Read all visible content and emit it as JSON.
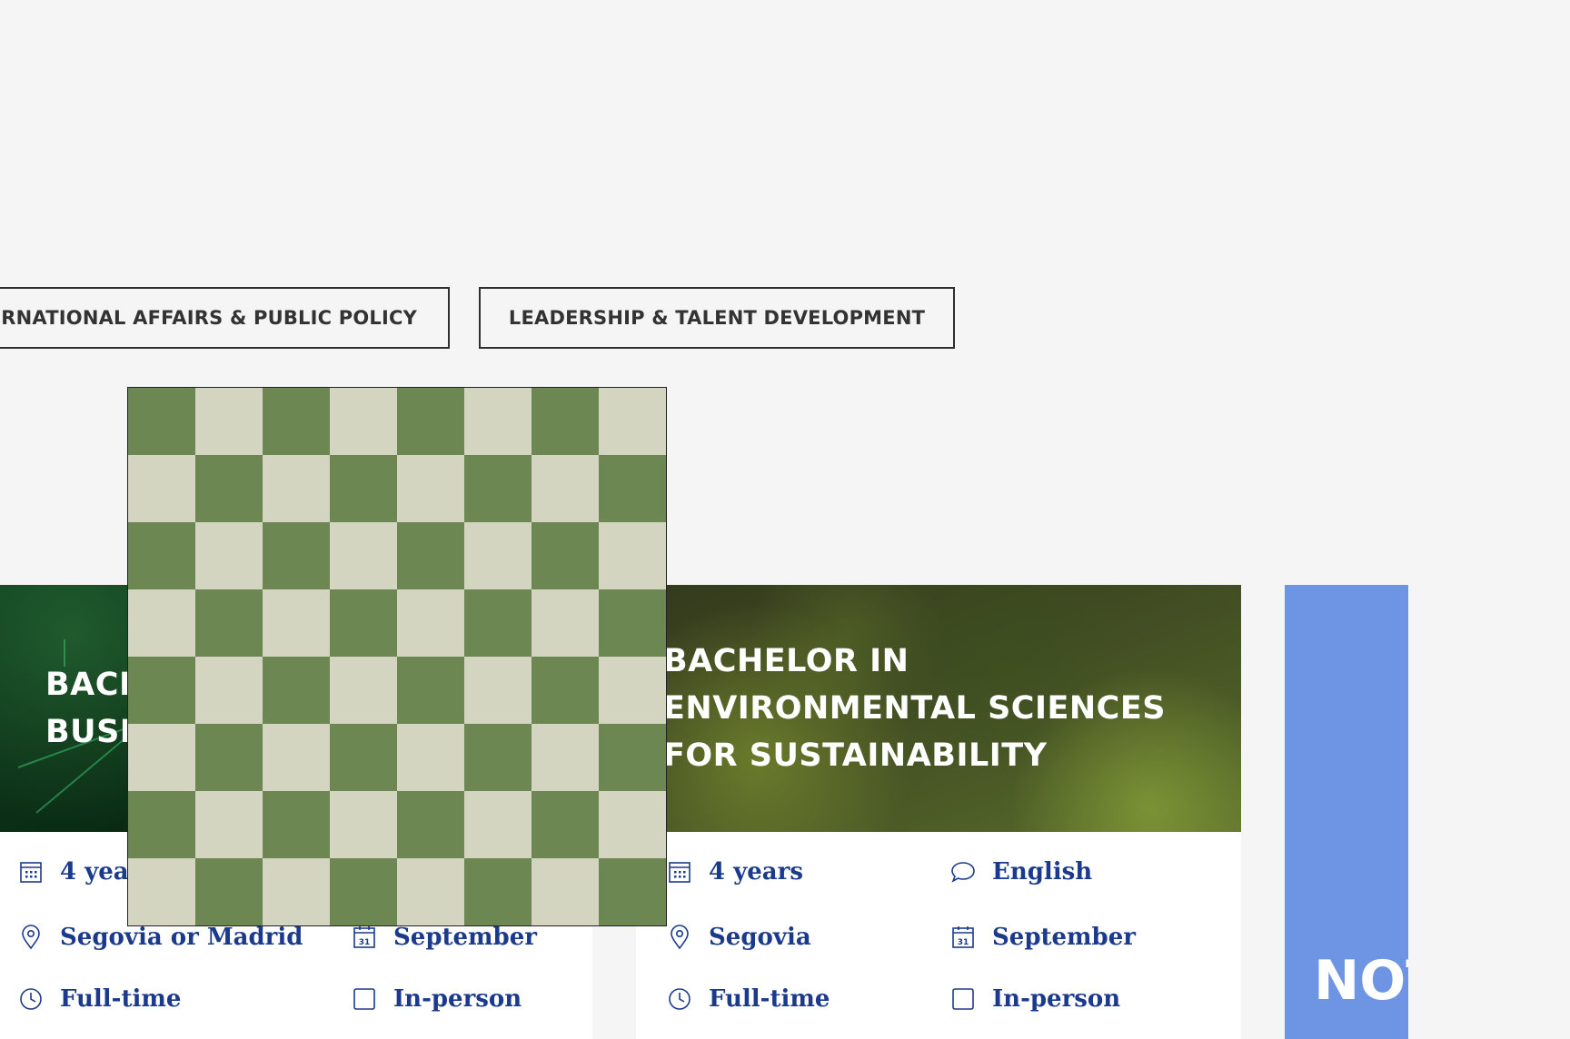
{
  "filters": [
    {
      "label": "INTERNATIONAL AFFAIRS & PUBLIC POLICY"
    },
    {
      "label": "LEADERSHIP & TALENT DEVELOPMENT"
    }
  ],
  "cards": [
    {
      "title_visible": "BACH\nBUSI",
      "facts": {
        "duration": "4 years",
        "location": "Segovia or Madrid",
        "start": "September",
        "schedule": "Full-time",
        "format": "In-person"
      }
    },
    {
      "title": "BACHELOR IN ENVIRONMENTAL SCIENCES FOR SUSTAINABILITY",
      "facts": {
        "duration": "4 years",
        "language": "English",
        "location": "Segovia",
        "start": "September",
        "schedule": "Full-time",
        "format": "In-person"
      }
    },
    {
      "word_visible": "NOT"
    }
  ],
  "colors": {
    "page_bg": "#f5f5f5",
    "fact_text": "#1b3a8c",
    "blue_card": "#6e95e4",
    "checker_dark": "#6c8752",
    "checker_light": "#d3d5c0"
  },
  "icons": [
    "calendar-grid-icon",
    "speech-bubble-icon",
    "location-pin-icon",
    "calendar-31-icon",
    "clock-icon",
    "square-icon"
  ]
}
